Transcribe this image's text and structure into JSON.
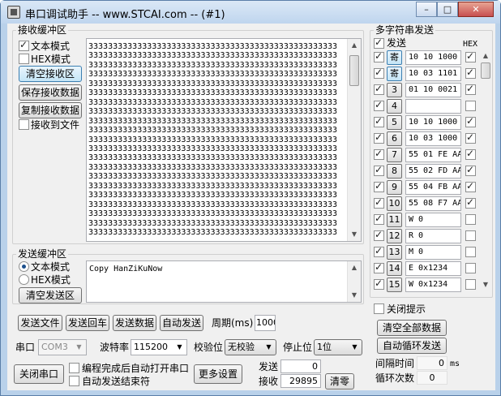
{
  "window": {
    "title": "串口调试助手 -- www.STCAI.com -- (#1)",
    "min": "–",
    "max": "□",
    "close": "✕"
  },
  "receive": {
    "group_label": "接收缓冲区",
    "text_mode": "文本模式",
    "text_mode_checked": true,
    "hex_mode": "HEX模式",
    "hex_mode_checked": false,
    "clear_btn": "清空接收区",
    "save_btn": "保存接收数据",
    "copy_btn": "复制接收数据",
    "to_file": "接收到文件",
    "to_file_checked": false,
    "content_line": "333333333333333333333333333333333333333333333333333",
    "line_count": 21
  },
  "send": {
    "group_label": "发送缓冲区",
    "text_mode": "文本模式",
    "hex_mode": "HEX模式",
    "text_mode_selected": true,
    "clear_btn": "清空发送区",
    "content": "Copy HanZiKuNow"
  },
  "actions": {
    "send_file": "发送文件",
    "send_enter": "发送回车",
    "send_data": "发送数据",
    "auto_send": "自动发送",
    "period_label": "周期(ms)",
    "period_value": "1000"
  },
  "port": {
    "port_label": "串口",
    "port_value": "COM3",
    "baud_label": "波特率",
    "baud_value": "115200",
    "parity_label": "校验位",
    "parity_value": "无校验",
    "stop_label": "停止位",
    "stop_value": "1位",
    "close_btn": "关闭串口",
    "auto_open": "编程完成后自动打开串口",
    "auto_send_end": "自动发送结束符",
    "more_btn": "更多设置",
    "sent_label": "发送",
    "sent_value": "0",
    "recv_label": "接收",
    "recv_value": "29895",
    "clear_btn": "清零"
  },
  "multi": {
    "group_label": "多字符串发送",
    "send_header": "发送",
    "hex_header": "HEX",
    "rows": [
      {
        "num": "寄",
        "value": "10 10 1000",
        "checked": true,
        "hex": true
      },
      {
        "num": "寄",
        "value": "10 03 1101",
        "checked": true,
        "hex": true
      },
      {
        "num": "3",
        "value": "01 10 0021",
        "checked": true,
        "hex": true
      },
      {
        "num": "4",
        "value": "",
        "checked": true,
        "hex": false
      },
      {
        "num": "5",
        "value": "10 10 1000",
        "checked": true,
        "hex": true
      },
      {
        "num": "6",
        "value": "10 03 1000",
        "checked": true,
        "hex": true
      },
      {
        "num": "7",
        "value": "55 01 FE AA",
        "checked": true,
        "hex": true
      },
      {
        "num": "8",
        "value": "55 02 FD AA",
        "checked": true,
        "hex": true
      },
      {
        "num": "9",
        "value": "55 04 FB AA",
        "checked": true,
        "hex": true
      },
      {
        "num": "10",
        "value": "55 08 F7 AA",
        "checked": true,
        "hex": true
      },
      {
        "num": "11",
        "value": "W 0",
        "checked": true,
        "hex": false
      },
      {
        "num": "12",
        "value": "R 0",
        "checked": true,
        "hex": false
      },
      {
        "num": "13",
        "value": "M 0",
        "checked": true,
        "hex": false
      },
      {
        "num": "14",
        "value": "E 0x1234",
        "checked": true,
        "hex": false
      },
      {
        "num": "15",
        "value": "W 0x1234",
        "checked": true,
        "hex": false
      }
    ],
    "close_tip": "关闭提示",
    "clear_all": "清空全部数据",
    "auto_loop": "自动循环发送",
    "interval_label": "间隔时间",
    "interval_value": "0",
    "interval_unit": "ms",
    "loop_label": "循环次数",
    "loop_value": "0"
  }
}
